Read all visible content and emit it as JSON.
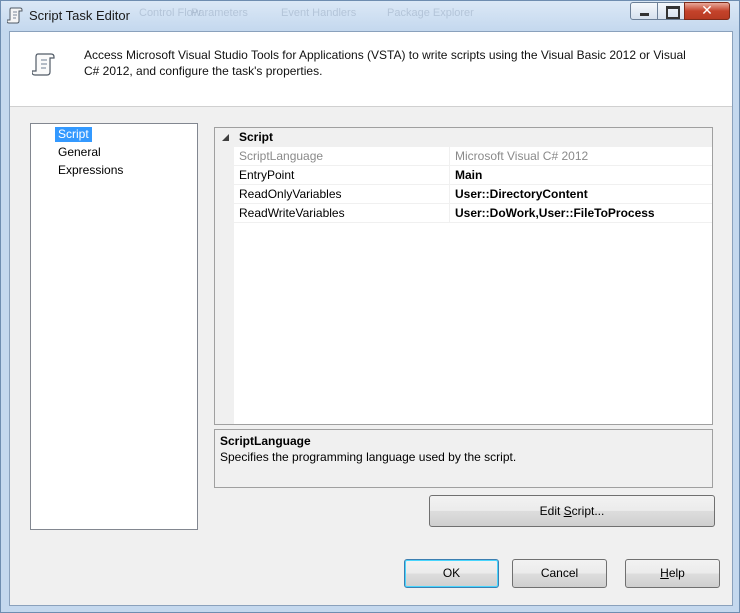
{
  "window": {
    "title": "Script Task Editor",
    "background_tabs": [
      "Control Flow",
      "Parameters",
      "Event Handlers",
      "Package Explorer"
    ]
  },
  "header": {
    "description": "Access Microsoft Visual Studio Tools for Applications (VSTA) to write scripts using the Visual Basic 2012 or Visual C# 2012, and configure the task's properties."
  },
  "nav": {
    "items": [
      {
        "label": "Script",
        "selected": true
      },
      {
        "label": "General",
        "selected": false
      },
      {
        "label": "Expressions",
        "selected": false
      }
    ]
  },
  "propgrid": {
    "category": "Script",
    "rows": [
      {
        "name": "ScriptLanguage",
        "value": "Microsoft Visual C# 2012",
        "disabled": true
      },
      {
        "name": "EntryPoint",
        "value": "Main",
        "disabled": false
      },
      {
        "name": "ReadOnlyVariables",
        "value": "User::DirectoryContent",
        "disabled": false
      },
      {
        "name": "ReadWriteVariables",
        "value": "User::DoWork,User::FileToProcess",
        "disabled": false
      }
    ]
  },
  "description_pane": {
    "title": "ScriptLanguage",
    "text": "Specifies the programming language used by the script."
  },
  "buttons": {
    "edit_script": {
      "pre": "Edit ",
      "mnemonic": "S",
      "post": "cript..."
    },
    "ok": "OK",
    "cancel": "Cancel",
    "help": {
      "mnemonic": "H",
      "post": "elp"
    }
  },
  "colors": {
    "selection": "#3399ff",
    "close_button": "#c4432b"
  }
}
